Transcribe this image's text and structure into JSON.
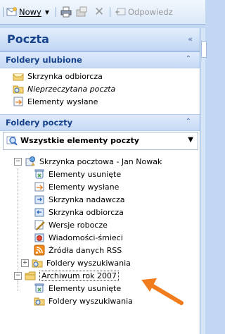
{
  "toolbar": {
    "new_label": "Nowy",
    "reply_label": "Odpowiedz"
  },
  "pane": {
    "title": "Poczta",
    "favorites_header": "Foldery ulubione",
    "favorites": [
      "Skrzynka odbiorcza",
      "Nieprzeczytana poczta",
      "Elementy wysłane"
    ],
    "folders_header": "Foldery poczty",
    "all_mail": "Wszystkie elementy poczty",
    "mailbox": "Skrzynka pocztowa - Jan Nowak",
    "mailbox_folders": [
      "Elementy usunięte",
      "Elementy wysłane",
      "Skrzynka nadawcza",
      "Skrzynka odbiorcza",
      "Wersje robocze",
      "Wiadomości-śmieci",
      "Źródła danych RSS",
      "Foldery wyszukiwania"
    ],
    "archive": "Archiwum rok 2007",
    "archive_folders": [
      "Elementy usunięte",
      "Foldery wyszukiwania"
    ]
  },
  "colors": {
    "header_text": "#15428b",
    "arrow": "#f07c1d"
  }
}
